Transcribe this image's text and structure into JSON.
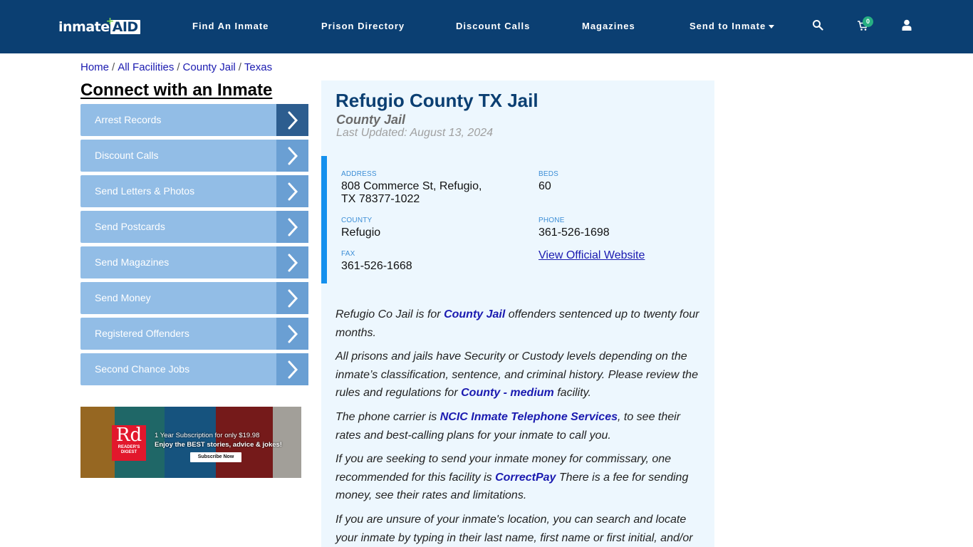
{
  "header": {
    "logo_text_main": "inmate",
    "logo_text_accent": "AID",
    "nav": [
      {
        "label": "Find An Inmate"
      },
      {
        "label": "Prison Directory"
      },
      {
        "label": "Discount Calls"
      },
      {
        "label": "Magazines"
      },
      {
        "label": "Send to Inmate"
      }
    ],
    "icons": [
      "search-icon",
      "cart-icon",
      "user-icon"
    ],
    "cart_count": "0",
    "colors": {
      "bar": "#0b3f72",
      "badge": "#27ae82"
    }
  },
  "breadcrumb": [
    {
      "label": "Home"
    },
    {
      "label": "All Facilities"
    },
    {
      "label": "County Jail"
    },
    {
      "label": "Texas"
    }
  ],
  "breadcrumb_separator": "/",
  "sidebar": {
    "title": "Connect with an Inmate",
    "items": [
      {
        "label": "Arrest Records"
      },
      {
        "label": "Discount Calls"
      },
      {
        "label": "Send Letters & Photos"
      },
      {
        "label": "Send Postcards"
      },
      {
        "label": "Send Magazines"
      },
      {
        "label": "Send Money"
      },
      {
        "label": "Registered Offenders"
      },
      {
        "label": "Second Chance Jobs"
      }
    ],
    "ad": {
      "brand_mark": "Rd",
      "brand_name": "READER'S DIGEST",
      "cover_title": "Reader's digest",
      "line1": "1 Year Subscription for only $19.98",
      "line2": "Enjoy the BEST stories, advice & jokes!",
      "cta": "Subscribe Now"
    }
  },
  "facility": {
    "title": "Refugio County TX Jail",
    "type": "County Jail",
    "last_updated": "Last Updated: August 13, 2024",
    "address_label": "ADDRESS",
    "address_line1": "808 Commerce St, Refugio,",
    "address_line2": "TX 78377-1022",
    "beds_label": "BEDS",
    "beds": "60",
    "county_label": "COUNTY",
    "county": "Refugio",
    "phone_label": "PHONE",
    "phone": "361-526-1698",
    "fax_label": "FAX",
    "fax": "361-526-1668",
    "website_link": "View Official Website"
  },
  "description": {
    "p1_a": "Refugio Co Jail is for ",
    "p1_link": "County Jail",
    "p1_b": " offenders sentenced up to twenty four months.",
    "p2_a": "All prisons and jails have Security or Custody levels depending on the inmate’s classification, sentence, and criminal history. Please review the rules and regulations for ",
    "p2_link": "County - medium",
    "p2_b": " facility.",
    "p3_a": "The phone carrier is ",
    "p3_link": "NCIC Inmate Telephone Services",
    "p3_b": ", to see their rates and best-calling plans for your inmate to call you.",
    "p4_a": "If you are seeking to send your inmate money for commissary, one recommended for this facility is ",
    "p4_link": "CorrectPay",
    "p4_b": " There is a fee for sending money, see their rates and limitations.",
    "p5": "If you are unsure of your inmate's location, you can search and locate your inmate by typing in their last name, first name or first initial, and/or"
  }
}
